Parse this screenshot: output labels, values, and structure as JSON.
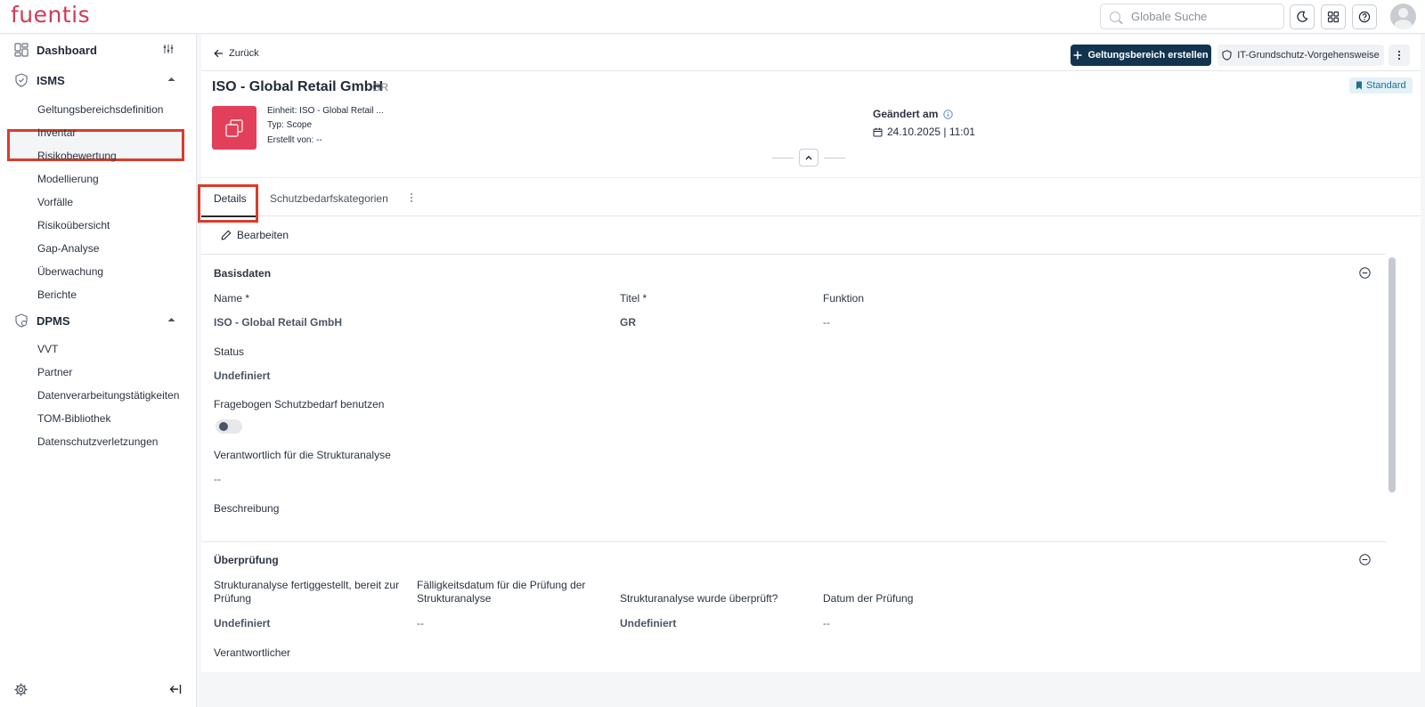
{
  "topbar": {
    "logo": "fuentis",
    "search_placeholder": "Globale Suche"
  },
  "sidebar": {
    "dashboard": "Dashboard",
    "isms": {
      "label": "ISMS",
      "items": [
        "Geltungsbereichsdefinition",
        "Inventar",
        "Risikobewertung",
        "Modellierung",
        "Vorfälle",
        "Risikoübersicht",
        "Gap-Analyse",
        "Überwachung",
        "Berichte"
      ]
    },
    "dpms": {
      "label": "DPMS",
      "items": [
        "VVT",
        "Partner",
        "Datenverarbeitungstätigkeiten",
        "TOM-Bibliothek",
        "Datenschutzverletzungen"
      ]
    }
  },
  "header": {
    "back_label": "Zurück",
    "create_button": "Geltungsbereich erstellen",
    "approach_button": "IT-Grundschutz-Vorgehensweise",
    "title": "ISO - Global Retail GmbH",
    "short": "GR",
    "badge": "Standard",
    "meta_unit": "Einheit: ISO - Global Retail ...",
    "meta_type": "Typ: Scope",
    "meta_created": "Erstellt von: --",
    "changed_label": "Geändert am",
    "changed_value": "24.10.2025 | 11:01"
  },
  "tabs": {
    "details": "Details",
    "schutz": "Schutzbedarfskategorien"
  },
  "edit_label": "Bearbeiten",
  "basisdaten": {
    "title": "Basisdaten",
    "name_label": "Name *",
    "name_value": "ISO - Global Retail GmbH",
    "titel_label": "Titel *",
    "titel_value": "GR",
    "funktion_label": "Funktion",
    "funktion_value": "--",
    "status_label": "Status",
    "status_value": "Undefiniert",
    "fragebogen_label": "Fragebogen Schutzbedarf benutzen",
    "verantwortlich_label": "Verantwortlich für die Strukturanalyse",
    "verantwortlich_value": "--",
    "beschreibung_label": "Beschreibung"
  },
  "ueberpruefung": {
    "title": "Überprüfung",
    "f1_label_1": "Strukturanalyse fertiggestellt, bereit zur",
    "f1_label_2": "Prüfung",
    "f1_value": "Undefiniert",
    "f2_label_1": "Fälligkeitsdatum für die Prüfung der",
    "f2_label_2": "Strukturanalyse",
    "f2_value": "--",
    "f3_label": "Strukturanalyse wurde überprüft?",
    "f3_value": "Undefiniert",
    "f4_label": "Datum der Prüfung",
    "f4_value": "--",
    "verantwortlicher_label": "Verantwortlicher"
  }
}
